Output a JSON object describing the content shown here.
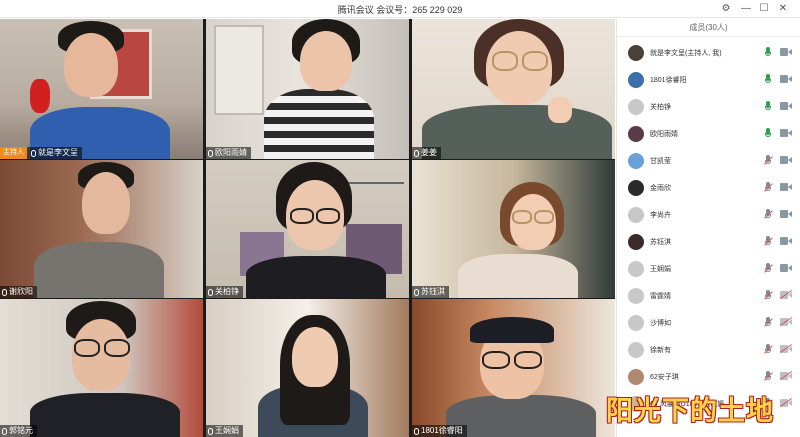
{
  "window": {
    "title": "腾讯会议 会议号：265 229 029",
    "controls": [
      "settings-icon",
      "minimize-icon",
      "maximize-icon",
      "close-icon"
    ]
  },
  "video_tiles": [
    {
      "name": "就是李文呈",
      "host_badge": "主持人"
    },
    {
      "name": "欧阳雨婧"
    },
    {
      "name": "姜姜"
    },
    {
      "name": "谢欣阳"
    },
    {
      "name": "关柏铮"
    },
    {
      "name": "苏钰淇"
    },
    {
      "name": "郭铭元"
    },
    {
      "name": "王娴娟"
    },
    {
      "name": "1801徐睿阳"
    }
  ],
  "members_panel": {
    "title": "成员(30人)",
    "members": [
      {
        "name": "就是李文呈(主持人, 我)",
        "mic": "on",
        "cam": "on",
        "avatar_color": "#4a4038"
      },
      {
        "name": "1801徐睿阳",
        "mic": "on",
        "cam": "on",
        "avatar_color": "#3a6fa8"
      },
      {
        "name": "关柏铮",
        "mic": "on",
        "cam": "on",
        "avatar_color": "#c8c8c8"
      },
      {
        "name": "欧阳雨婧",
        "mic": "on",
        "cam": "on",
        "avatar_color": "#5a3a4a"
      },
      {
        "name": "甘凯莹",
        "mic": "muted",
        "cam": "on",
        "avatar_color": "#6aa0d8"
      },
      {
        "name": "金雨欣",
        "mic": "muted",
        "cam": "on",
        "avatar_color": "#2a2a2a"
      },
      {
        "name": "李尚卉",
        "mic": "muted",
        "cam": "on",
        "avatar_color": "#c8c8c8"
      },
      {
        "name": "苏钰淇",
        "mic": "muted",
        "cam": "on",
        "avatar_color": "#3a2a2a"
      },
      {
        "name": "王娴娟",
        "mic": "muted",
        "cam": "on",
        "avatar_color": "#c8c8c8"
      },
      {
        "name": "雷霆婧",
        "mic": "muted",
        "cam": "muted",
        "avatar_color": "#c8c8c8"
      },
      {
        "name": "沙博如",
        "mic": "muted",
        "cam": "muted",
        "avatar_color": "#c8c8c8"
      },
      {
        "name": "徐新有",
        "mic": "muted",
        "cam": "muted",
        "avatar_color": "#c8c8c8"
      },
      {
        "name": "62安子琪",
        "mic": "muted",
        "cam": "muted",
        "avatar_color": "#b08870"
      },
      {
        "name": "64 风暴阿U1801 威敬媛",
        "mic": "muted",
        "cam": "muted",
        "avatar_color": "#c8b890"
      }
    ]
  },
  "watermark": "阳光下的土地"
}
